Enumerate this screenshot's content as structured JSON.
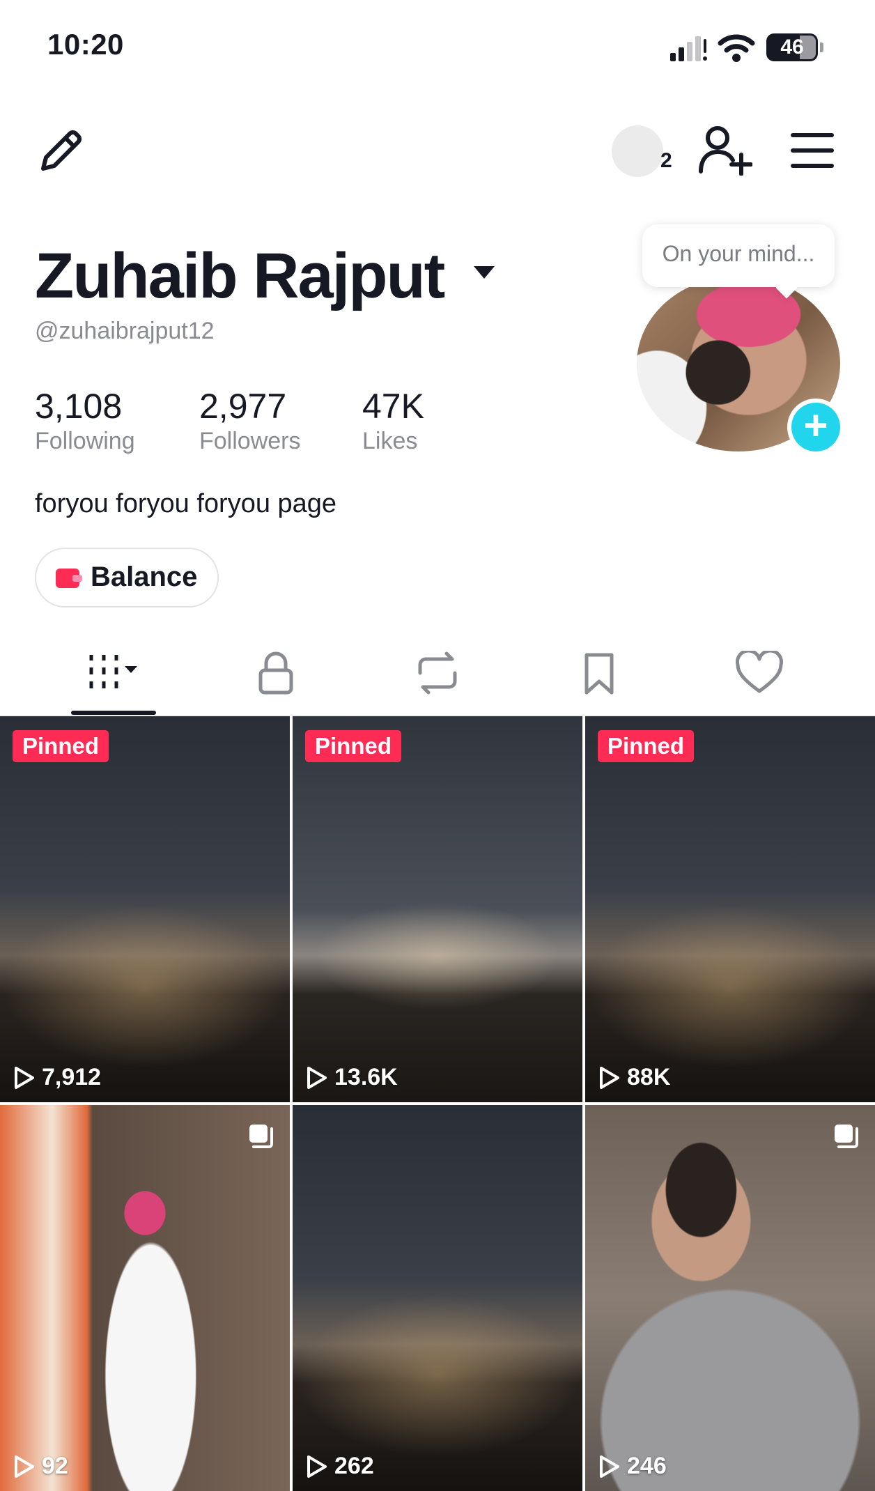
{
  "status_bar": {
    "time": "10:20",
    "battery": "46"
  },
  "header": {
    "story_count": "2"
  },
  "profile": {
    "name": "Zuhaib Rajput",
    "handle": "@zuhaibrajput12",
    "bubble_text": "On your mind...",
    "bio": "foryou foryou foryou page",
    "balance_label": "Balance",
    "stats": [
      {
        "value": "3,108",
        "label": "Following"
      },
      {
        "value": "2,977",
        "label": "Followers"
      },
      {
        "value": "47K",
        "label": "Likes"
      }
    ]
  },
  "tabs": [
    {
      "name": "videos",
      "icon": "grid-icon",
      "active": true
    },
    {
      "name": "private",
      "icon": "lock-icon",
      "active": false
    },
    {
      "name": "reposts",
      "icon": "repost-icon",
      "active": false
    },
    {
      "name": "favorites",
      "icon": "bookmark-icon",
      "active": false
    },
    {
      "name": "liked",
      "icon": "heart-icon",
      "active": false
    }
  ],
  "videos": [
    {
      "badge": "Pinned",
      "views": "7,912",
      "multi_image": false
    },
    {
      "badge": "Pinned",
      "views": "13.6K",
      "multi_image": false
    },
    {
      "badge": "Pinned",
      "views": "88K",
      "multi_image": false
    },
    {
      "badge": "",
      "views": "92",
      "multi_image": true
    },
    {
      "badge": "",
      "views": "262",
      "multi_image": false
    },
    {
      "badge": "",
      "views": "246",
      "multi_image": true
    }
  ],
  "colors": {
    "accent": "#fe2c55",
    "plus": "#20d5ec",
    "text": "#161823",
    "muted": "#8a8b91"
  }
}
